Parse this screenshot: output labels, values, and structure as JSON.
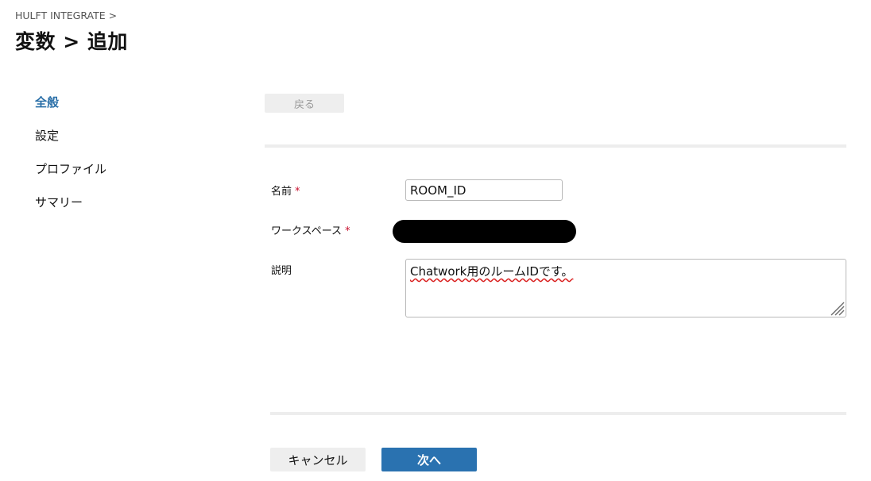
{
  "header": {
    "breadcrumb": "HULFT INTEGRATE >",
    "title": "変数 > 追加"
  },
  "sidebar": {
    "items": [
      {
        "label": "全般",
        "active": true
      },
      {
        "label": "設定",
        "active": false
      },
      {
        "label": "プロファイル",
        "active": false
      },
      {
        "label": "サマリー",
        "active": false
      }
    ]
  },
  "toolbar": {
    "back_label": "戻る"
  },
  "form": {
    "name_label": "名前",
    "name_value": "ROOM_ID",
    "workspace_label": "ワークスペース",
    "description_label": "説明",
    "description_value": "Chatwork用のルームIDです。",
    "required_mark": "*"
  },
  "footer": {
    "cancel_label": "キャンセル",
    "next_label": "次へ"
  },
  "colors": {
    "accent": "#2a72b0",
    "active_nav": "#2a6fa8",
    "required": "#c8102e"
  }
}
